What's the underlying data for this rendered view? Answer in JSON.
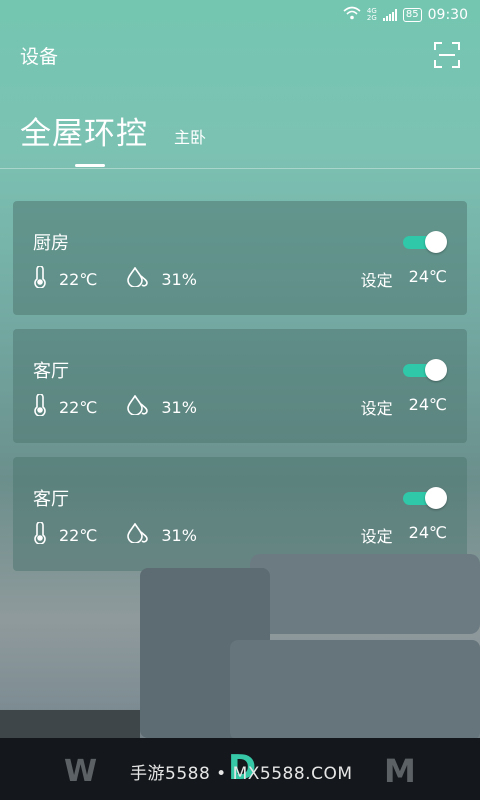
{
  "status": {
    "network": "4G 2G",
    "battery": "85",
    "time": "09:30"
  },
  "header": {
    "title": "设备",
    "scan_icon": "scan-icon"
  },
  "tabs": {
    "active": "全屋环控",
    "secondary": "主卧"
  },
  "rooms": [
    {
      "name": "厨房",
      "temperature": "22℃",
      "humidity": "31%",
      "set_label": "设定",
      "set_temperature": "24℃",
      "on": true
    },
    {
      "name": "客厅",
      "temperature": "22℃",
      "humidity": "31%",
      "set_label": "设定",
      "set_temperature": "24℃",
      "on": true
    },
    {
      "name": "客厅",
      "temperature": "22℃",
      "humidity": "31%",
      "set_label": "设定",
      "set_temperature": "24℃",
      "on": true
    }
  ],
  "banner": {
    "watermark": "手游5588 • MX5588.COM",
    "logo_left": "W",
    "logo_center": "D",
    "logo_right": "M"
  },
  "colors": {
    "accent": "#2fc8a8",
    "banner_bg": "#14181c"
  }
}
